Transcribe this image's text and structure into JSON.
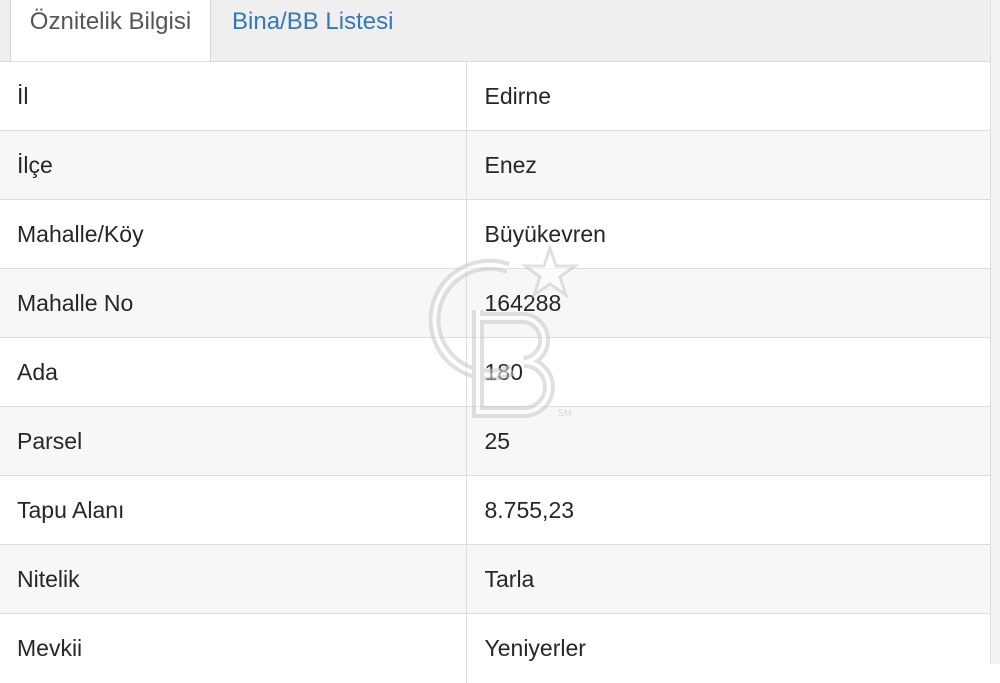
{
  "tabs": [
    {
      "label": "Öznitelik Bilgisi",
      "active": true
    },
    {
      "label": "Bina/BB Listesi",
      "active": false
    }
  ],
  "rows": [
    {
      "label": "İl",
      "value": "Edirne"
    },
    {
      "label": "İlçe",
      "value": "Enez"
    },
    {
      "label": "Mahalle/Köy",
      "value": "Büyükevren"
    },
    {
      "label": "Mahalle No",
      "value": "164288"
    },
    {
      "label": "Ada",
      "value": "180"
    },
    {
      "label": "Parsel",
      "value": "25"
    },
    {
      "label": "Tapu Alanı",
      "value": "8.755,23"
    },
    {
      "label": "Nitelik",
      "value": "Tarla"
    },
    {
      "label": "Mevkii",
      "value": "Yeniyerler"
    }
  ],
  "watermark": {
    "icon": "cb-logo-watermark",
    "mark": "SM"
  },
  "colors": {
    "tab_link": "#3379b7",
    "text": "#262626",
    "stripe": "#f7f7f7",
    "border": "#dddddd"
  }
}
